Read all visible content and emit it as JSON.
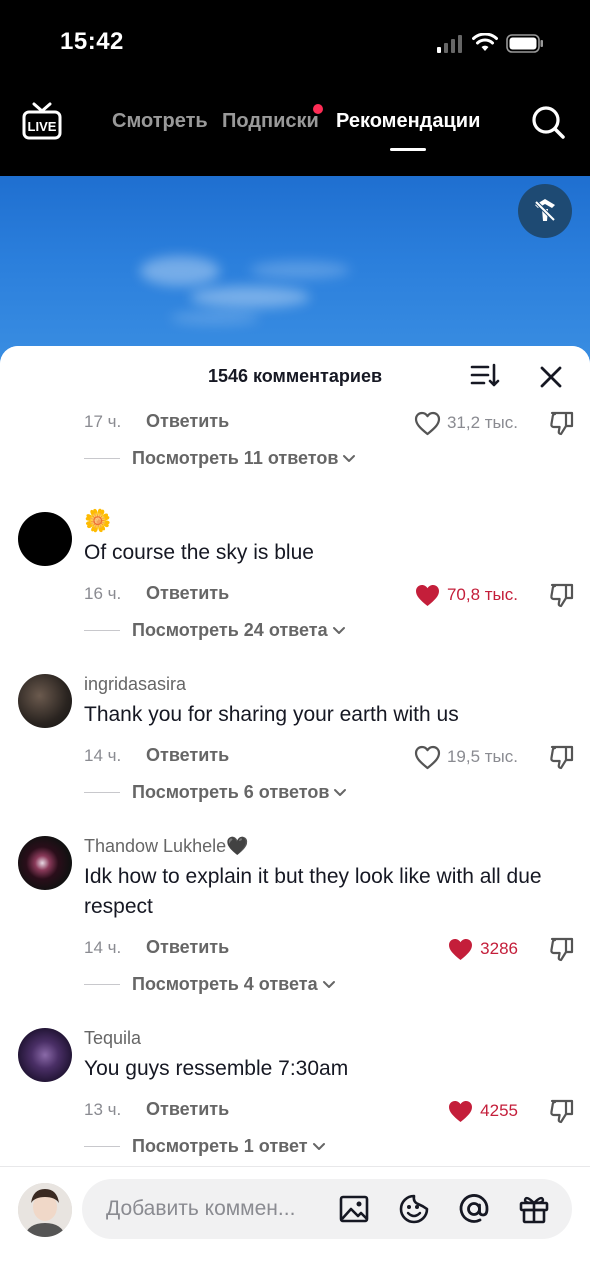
{
  "status_bar": {
    "time": "15:42"
  },
  "nav": {
    "live_label": "LIVE",
    "tabs": [
      {
        "label": "Смотреть",
        "active": false,
        "has_dot": false
      },
      {
        "label": "Подписки",
        "active": false,
        "has_dot": true
      },
      {
        "label": "Рекомендации",
        "active": true,
        "has_dot": false
      }
    ],
    "icons": {
      "live": "live-tv-icon",
      "search": "search-icon"
    }
  },
  "video": {
    "flag_icon": "not-interested-icon"
  },
  "comments_sheet": {
    "title": "1546 комментариев",
    "sort_icon": "sort-icon",
    "close_icon": "close-icon",
    "reply_label": "Ответить",
    "comments": [
      {
        "username": "",
        "text": "",
        "time": "17 ч.",
        "likes": "31,2 тыс.",
        "liked": false,
        "view_replies": "Посмотреть 11 ответов"
      },
      {
        "username": "🌼",
        "text": "Of course the sky is blue",
        "time": "16 ч.",
        "likes": "70,8 тыс.",
        "liked": true,
        "view_replies": "Посмотреть 24 ответа"
      },
      {
        "username": "ingridasasira",
        "text": "Thank you for sharing your earth with us",
        "time": "14 ч.",
        "likes": "19,5 тыс.",
        "liked": false,
        "view_replies": "Посмотреть 6 ответов"
      },
      {
        "username": "Thandow Lukhele🖤",
        "text": "Idk how to explain it but they look like with all due respect",
        "time": "14 ч.",
        "likes": "3286",
        "liked": true,
        "view_replies": "Посмотреть 4 ответа"
      },
      {
        "username": "Tequila",
        "text": "You guys ressemble 7:30am",
        "time": "13 ч.",
        "likes": "4255",
        "liked": true,
        "view_replies": "Посмотреть 1 ответ"
      }
    ]
  },
  "comment_input": {
    "placeholder": "Добавить коммен...",
    "icons": [
      "image-icon",
      "emoji-icon",
      "mention-icon",
      "gift-icon"
    ]
  },
  "colors": {
    "liked": "#c41e3a",
    "notification_dot": "#fe2c55",
    "sky": "#2b7fdc"
  }
}
